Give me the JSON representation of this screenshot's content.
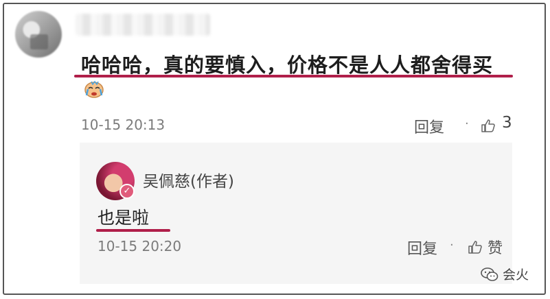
{
  "comment": {
    "text": "哈哈哈，真的要慎入，价格不是人人都舍得买",
    "time": "10-15 20:13",
    "reply_label": "回复",
    "separator": "·",
    "like_count": "3"
  },
  "author_reply": {
    "author": "吴佩慈(作者)",
    "text": "也是啦",
    "time": "10-15 20:20",
    "reply_label": "回复",
    "separator": "·",
    "like_label": "赞"
  },
  "watermark": {
    "text": "会火"
  },
  "colors": {
    "underline": "#b01f4a",
    "panel_bg": "#f5f5f5",
    "meta_text": "#7b7b7b"
  }
}
